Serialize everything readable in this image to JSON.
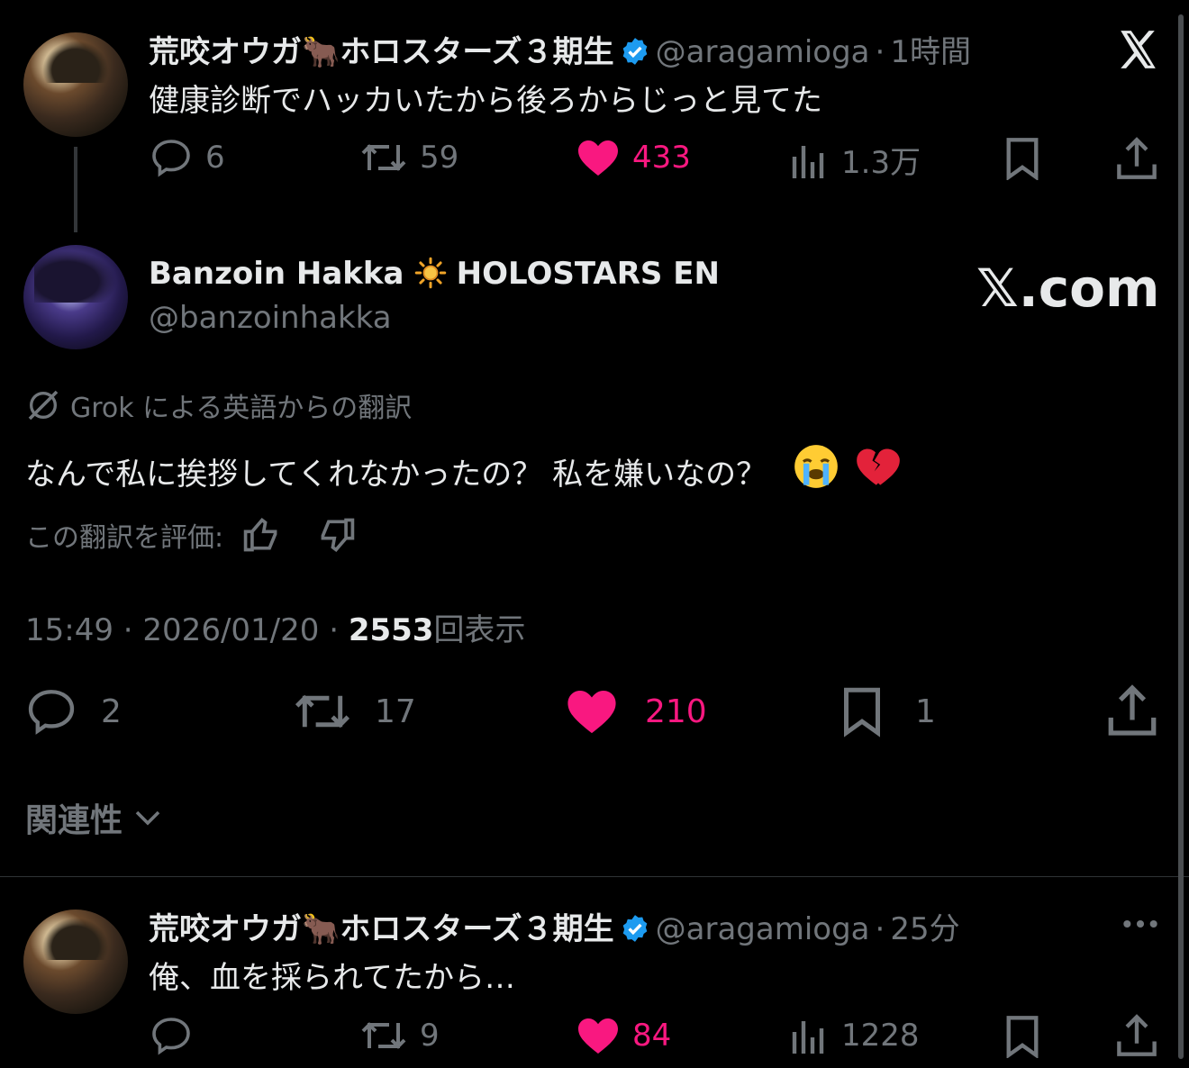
{
  "tweet1": {
    "name": "荒咬オウガ🐂ホロスターズ３期生",
    "handle": "@aragamioga",
    "sep": "·",
    "time": "1時間",
    "text": "健康診断でハッカいたから後ろからじっと見てた",
    "replies": "6",
    "reposts": "59",
    "likes": "433",
    "views": "1.3万"
  },
  "quoted": {
    "name": "Banzoin Hakka",
    "name_badge": "HOLOSTARS EN",
    "handle": "@banzoinhakka",
    "site": "𝕏.com",
    "translation_label": "Grok による英語からの翻訳",
    "text": "なんで私に挨拶してくれなかったの？ 私を嫌いなの？",
    "rate_label": "この翻訳を評価:",
    "time": "15:49",
    "date": "2026/01/20",
    "sep": "·",
    "views_count": "2553",
    "views_label": "回表示",
    "replies": "2",
    "reposts": "17",
    "likes": "210",
    "bookmarks": "1"
  },
  "sort": {
    "label": "関連性"
  },
  "reply": {
    "name": "荒咬オウガ🐂ホロスターズ３期生",
    "handle": "@aragamioga",
    "sep": "·",
    "time": "25分",
    "text": "俺、血を採られてたから…",
    "replies": "",
    "reposts": "9",
    "likes": "84",
    "views": "1228"
  },
  "colors": {
    "like": "#f91880",
    "verified": "#1d9bf0",
    "muted": "#71767b",
    "text": "#e7e9ea"
  }
}
